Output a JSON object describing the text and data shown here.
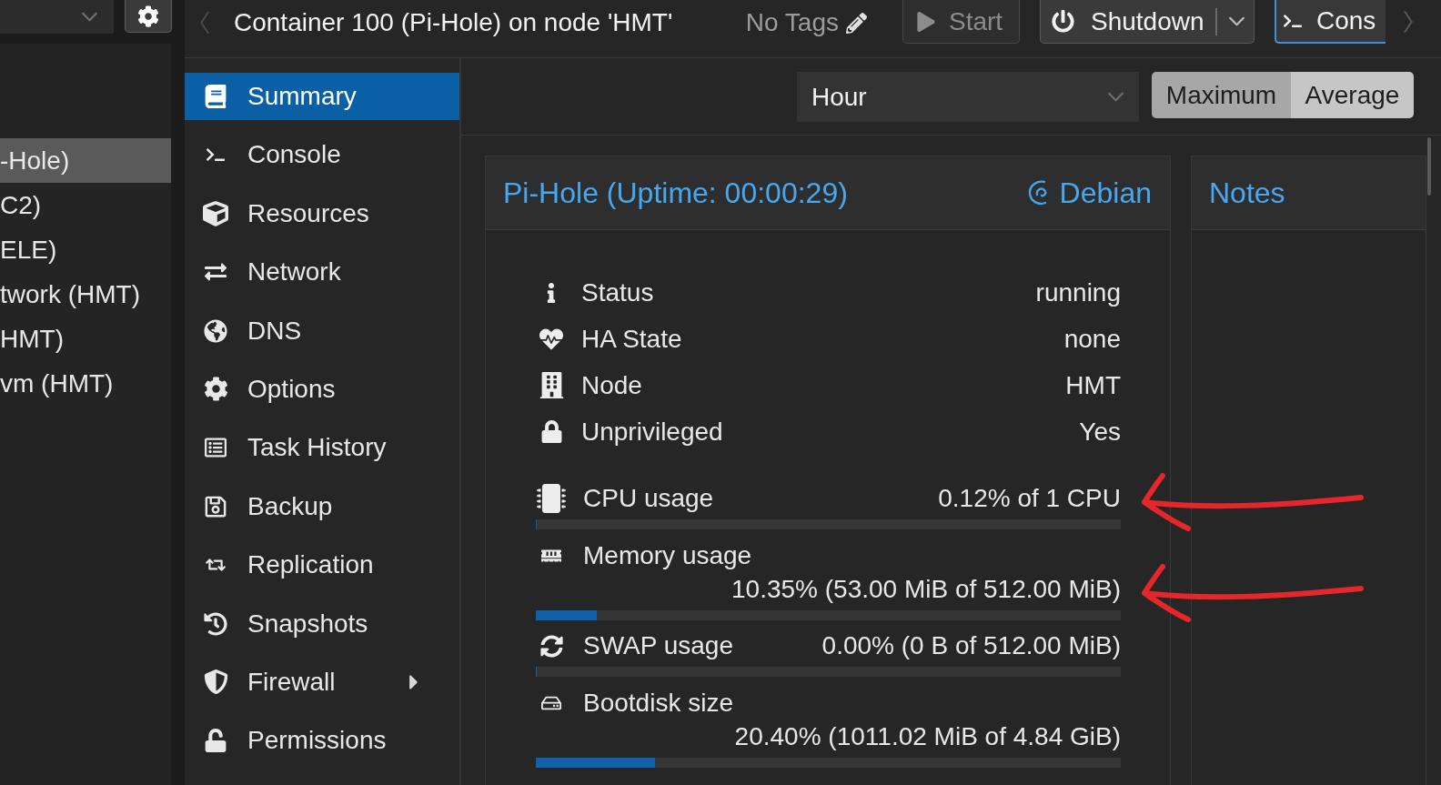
{
  "resource_tree": {
    "items": [
      {
        "label": "-Hole)",
        "selected": true
      },
      {
        "label": "C2)",
        "selected": false
      },
      {
        "label": "ELE)",
        "selected": false
      },
      {
        "label": "twork (HMT)",
        "selected": false
      },
      {
        "label": "HMT)",
        "selected": false
      },
      {
        "label": "vm (HMT)",
        "selected": false
      }
    ]
  },
  "header": {
    "title": "Container 100 (Pi-Hole) on node 'HMT'",
    "tags": "No Tags",
    "buttons": [
      {
        "kind": "start",
        "label": "Start",
        "disabled": true,
        "focused": false
      },
      {
        "kind": "shutdown",
        "label": "Shutdown",
        "disabled": false,
        "focused": false
      },
      {
        "kind": "console",
        "label": "Cons",
        "disabled": false,
        "focused": true
      }
    ]
  },
  "nav_menu": {
    "items": [
      {
        "label": "Summary",
        "selected": true,
        "expandable": false
      },
      {
        "label": "Console",
        "selected": false,
        "expandable": false
      },
      {
        "label": "Resources",
        "selected": false,
        "expandable": false
      },
      {
        "label": "Network",
        "selected": false,
        "expandable": false
      },
      {
        "label": "DNS",
        "selected": false,
        "expandable": false
      },
      {
        "label": "Options",
        "selected": false,
        "expandable": false
      },
      {
        "label": "Task History",
        "selected": false,
        "expandable": false
      },
      {
        "label": "Backup",
        "selected": false,
        "expandable": false
      },
      {
        "label": "Replication",
        "selected": false,
        "expandable": false
      },
      {
        "label": "Snapshots",
        "selected": false,
        "expandable": false
      },
      {
        "label": "Firewall",
        "selected": false,
        "expandable": true
      },
      {
        "label": "Permissions",
        "selected": false,
        "expandable": false
      }
    ]
  },
  "toolbar": {
    "timeframe": {
      "value": "Hour"
    },
    "mode": [
      {
        "label": "Maximum",
        "selected": true
      },
      {
        "label": "Average",
        "selected": false
      }
    ]
  },
  "status_panel": {
    "title": "Pi-Hole (Uptime: 00:00:29)",
    "os": "Debian",
    "info": [
      {
        "label": "Status",
        "value": "running"
      },
      {
        "label": "HA State",
        "value": "none"
      },
      {
        "label": "Node",
        "value": "HMT"
      },
      {
        "label": "Unprivileged",
        "value": "Yes"
      }
    ],
    "resources": [
      {
        "kind": "inline",
        "label": "CPU usage",
        "value": "0.12% of 1 CPU",
        "level": 0.0012,
        "annotated": true
      },
      {
        "kind": "stacked",
        "label": "Memory usage",
        "value": "10.35% (53.00 MiB of 512.00 MiB)",
        "level": 0.1035,
        "annotated": true
      },
      {
        "kind": "inline",
        "label": "SWAP usage",
        "value": "0.00% (0 B of 512.00 MiB)",
        "level": 0,
        "annotated": false
      },
      {
        "kind": "stacked",
        "label": "Bootdisk size",
        "value": "20.40% (1011.02 MiB of 4.84 GiB)",
        "level": 0.204,
        "annotated": false
      }
    ]
  },
  "notes_panel": {
    "title": "Notes"
  }
}
